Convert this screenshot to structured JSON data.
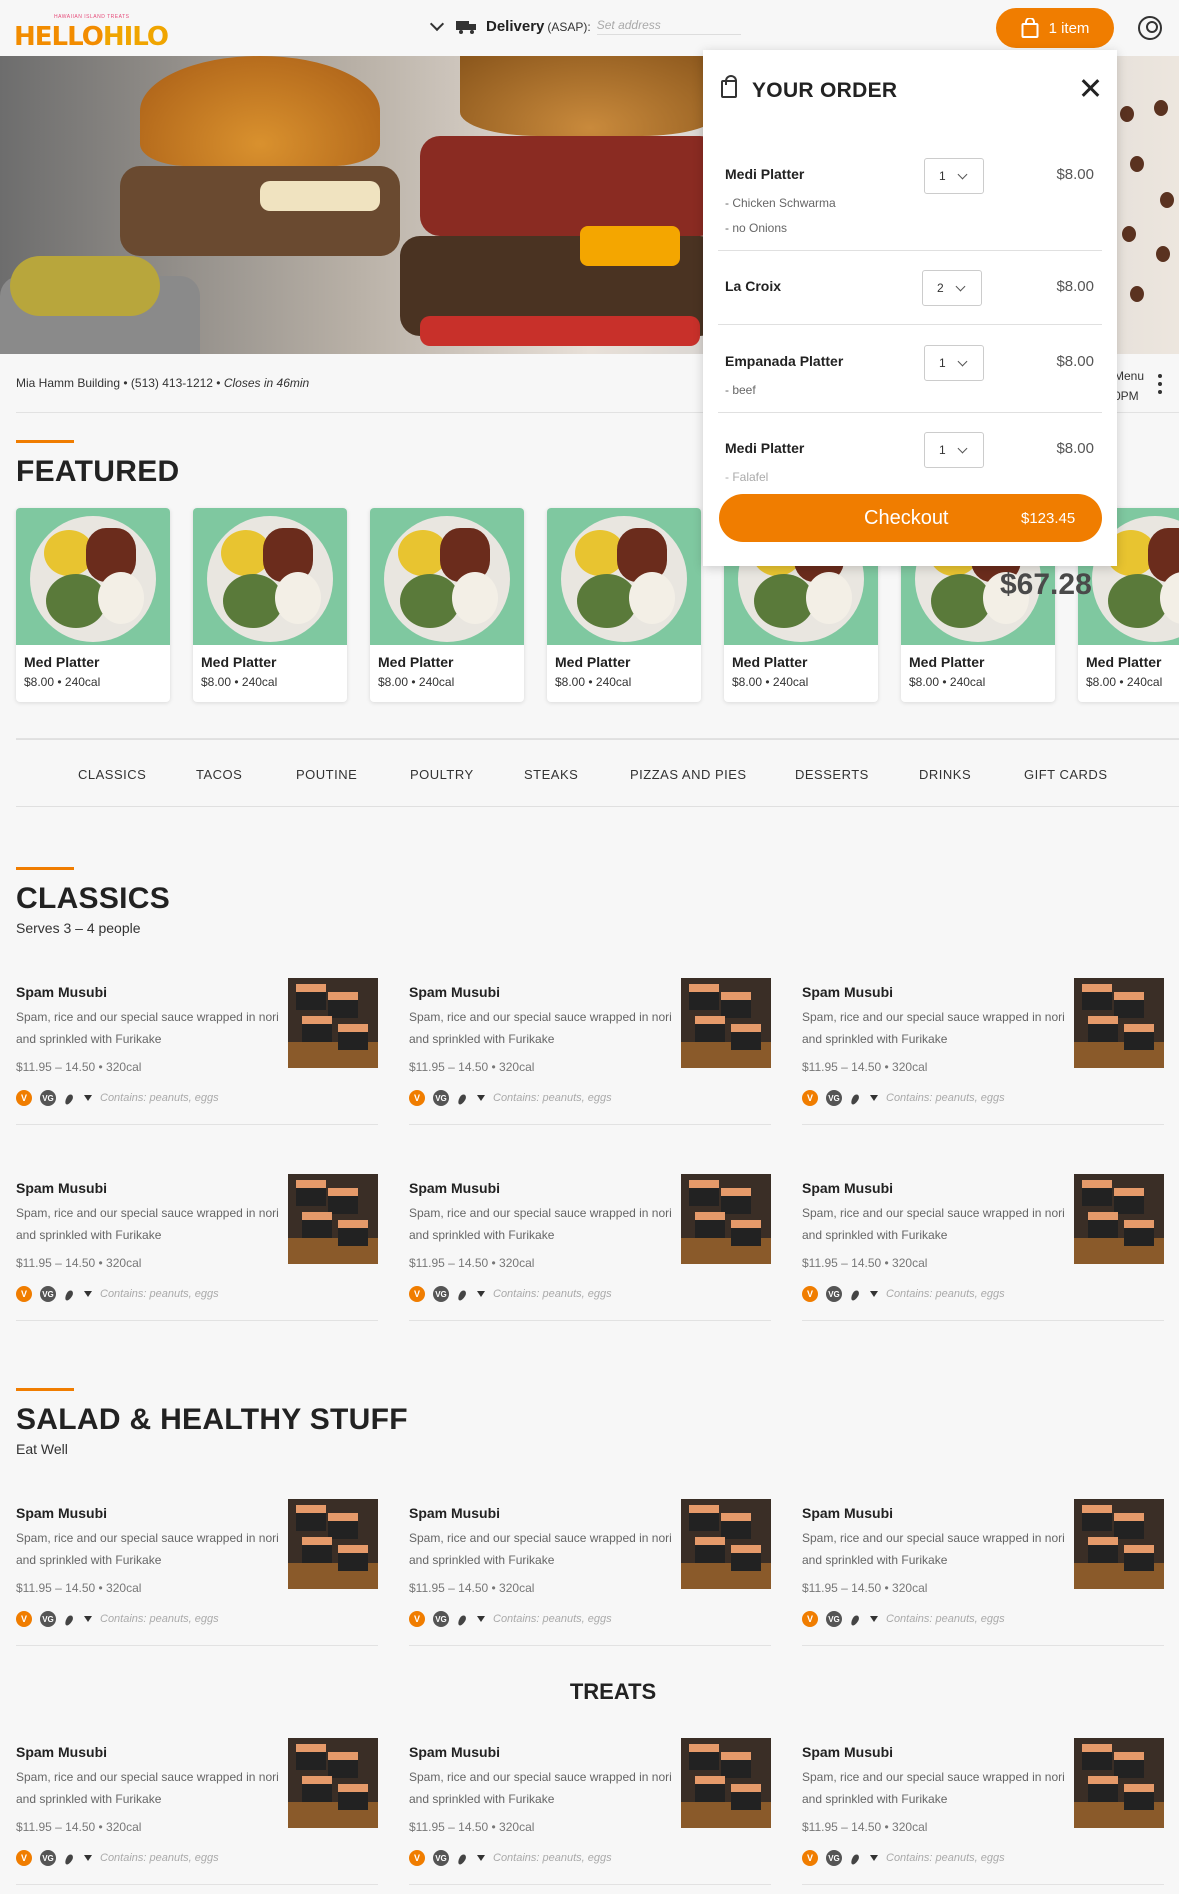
{
  "header": {
    "logo_tagline": "HAWAIIAN ISLAND TREATS",
    "logo_text_1": "HELLO",
    "logo_text_2": "HILO",
    "delivery_label": "Delivery",
    "delivery_timing": "(ASAP):",
    "address_placeholder": "Set address",
    "cart_label": "1 item"
  },
  "info": {
    "location": "Mia Hamm Building • (513) 413-1212 • ",
    "closes": "Closes in 46min",
    "right_line1": "Menu",
    "right_line2": "0PM"
  },
  "featured": {
    "title": "FEATURED",
    "overlay_price": "$67.28",
    "items": [
      {
        "name": "Med Platter",
        "meta": "$8.00  •  240cal"
      },
      {
        "name": "Med Platter",
        "meta": "$8.00  •  240cal"
      },
      {
        "name": "Med Platter",
        "meta": "$8.00  •  240cal"
      },
      {
        "name": "Med Platter",
        "meta": "$8.00  •  240cal"
      },
      {
        "name": "Med Platter",
        "meta": "$8.00  •  240cal"
      },
      {
        "name": "Med Platter",
        "meta": "$8.00  •  240cal"
      },
      {
        "name": "Med Platter",
        "meta": "$8.00  •  240cal"
      }
    ]
  },
  "nav": [
    "CLASSICS",
    "TACOS",
    "POUTINE",
    "POULTRY",
    "STEAKS",
    "PIZZAS AND PIES",
    "DESSERTS",
    "DRINKS",
    "GIFT CARDS"
  ],
  "sections": {
    "classics": {
      "title": "CLASSICS",
      "subtitle": "Serves 3 – 4 people"
    },
    "salad": {
      "title": "SALAD & HEALTHY STUFF",
      "subtitle": "Eat Well"
    },
    "treats": {
      "title": "TREATS"
    }
  },
  "menu_item": {
    "name": "Spam Musubi",
    "desc": "Spam, rice and our special sauce wrapped in nori and sprinkled with Furikake",
    "price": "$11.95 – 14.50  •  320cal",
    "badge_v": "V",
    "badge_vg": "VG",
    "contains": "Contains: peanuts, eggs"
  },
  "order": {
    "title": "YOUR ORDER",
    "items": [
      {
        "name": "Medi Platter",
        "mod1": "- Chicken Schwarma",
        "mod2": "- no Onions",
        "qty": "1",
        "price": "$8.00"
      },
      {
        "name": "La Croix",
        "mod1": "",
        "mod2": "",
        "qty": "2",
        "price": "$8.00"
      },
      {
        "name": "Empanada Platter",
        "mod1": "- beef",
        "mod2": "",
        "qty": "1",
        "price": "$8.00"
      },
      {
        "name": "Medi Platter",
        "mod1": "- Falafel",
        "mod2": "",
        "qty": "1",
        "price": "$8.00"
      }
    ],
    "checkout_label": "Checkout",
    "checkout_total": "$123.45"
  },
  "colors": {
    "accent": "#f07d00",
    "text": "#222222"
  }
}
